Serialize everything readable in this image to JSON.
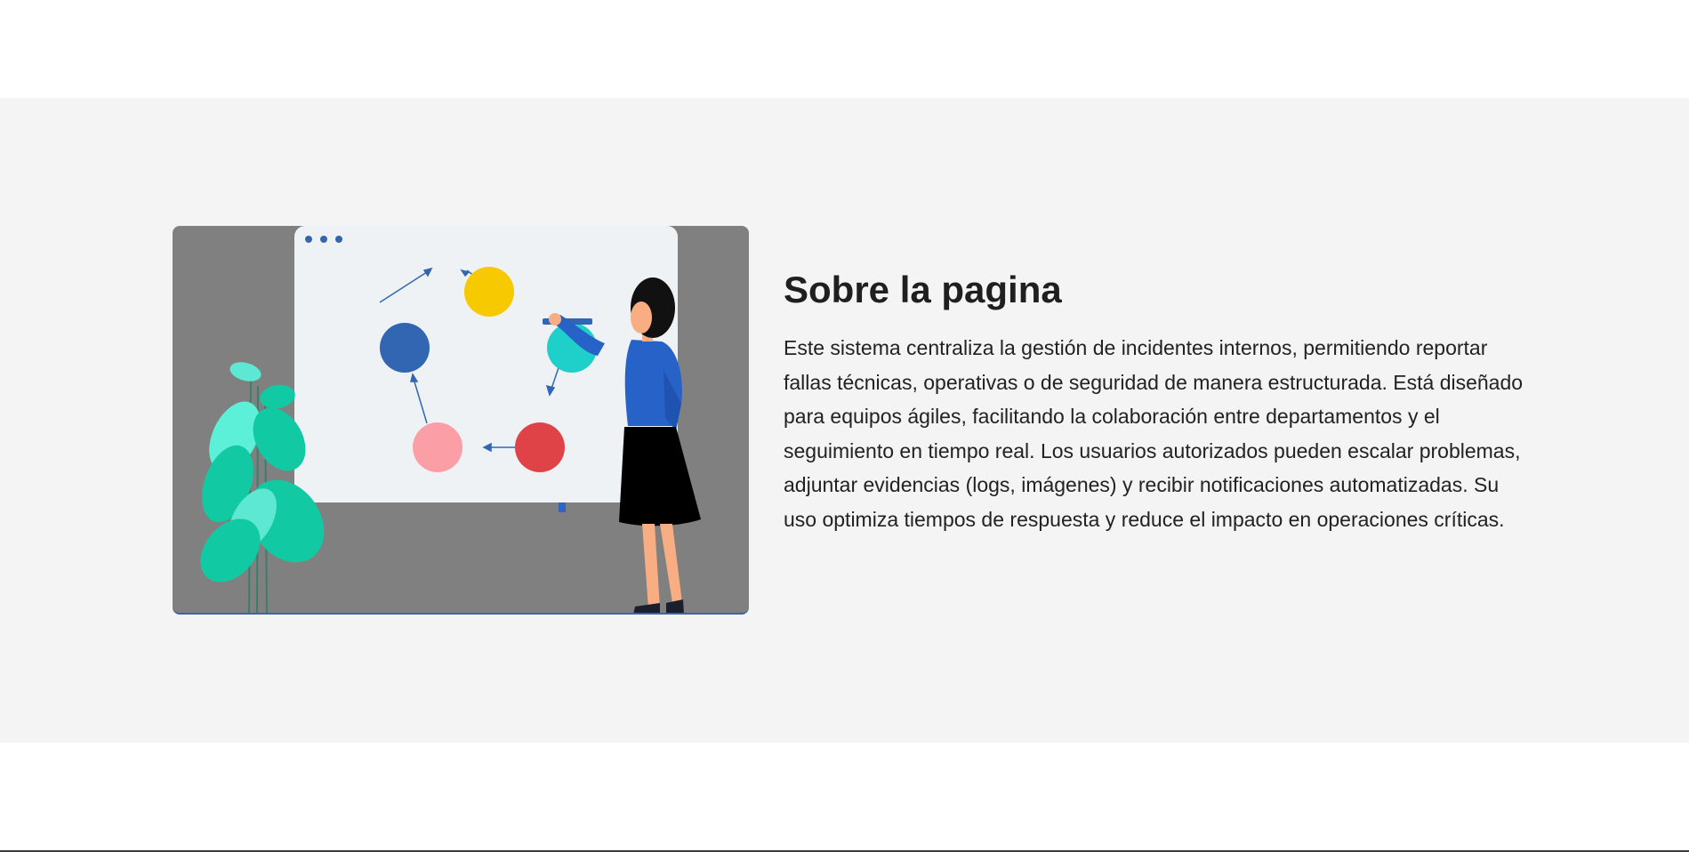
{
  "about": {
    "title": "Sobre la pagina",
    "body": "Este sistema centraliza la gestión de incidentes internos, permitiendo reportar fallas técnicas, operativas o de seguridad de manera estructurada. Está diseñado para equipos ágiles, facilitando la colaboración entre departamentos y el seguimiento en tiempo real. Los usuarios autorizados pueden escalar problemas, adjuntar evidencias (logs, imágenes) y recibir notificaciones automatizadas. Su uso optimiza tiempos de respuesta y reduce el impacto en operaciones críticas."
  },
  "illustration": {
    "icon": "woman-presenting-cycle-diagram-illustration",
    "colors": {
      "background": "#808080",
      "board": "#eff2f5",
      "node_yellow": "#f7c900",
      "node_blue": "#3266b2",
      "node_teal": "#1fcfca",
      "node_pink": "#fc9ea6",
      "node_red": "#df4247",
      "plant": "#11c9a3",
      "shirt": "#2762c9"
    }
  },
  "section_background": "#f4f4f4"
}
